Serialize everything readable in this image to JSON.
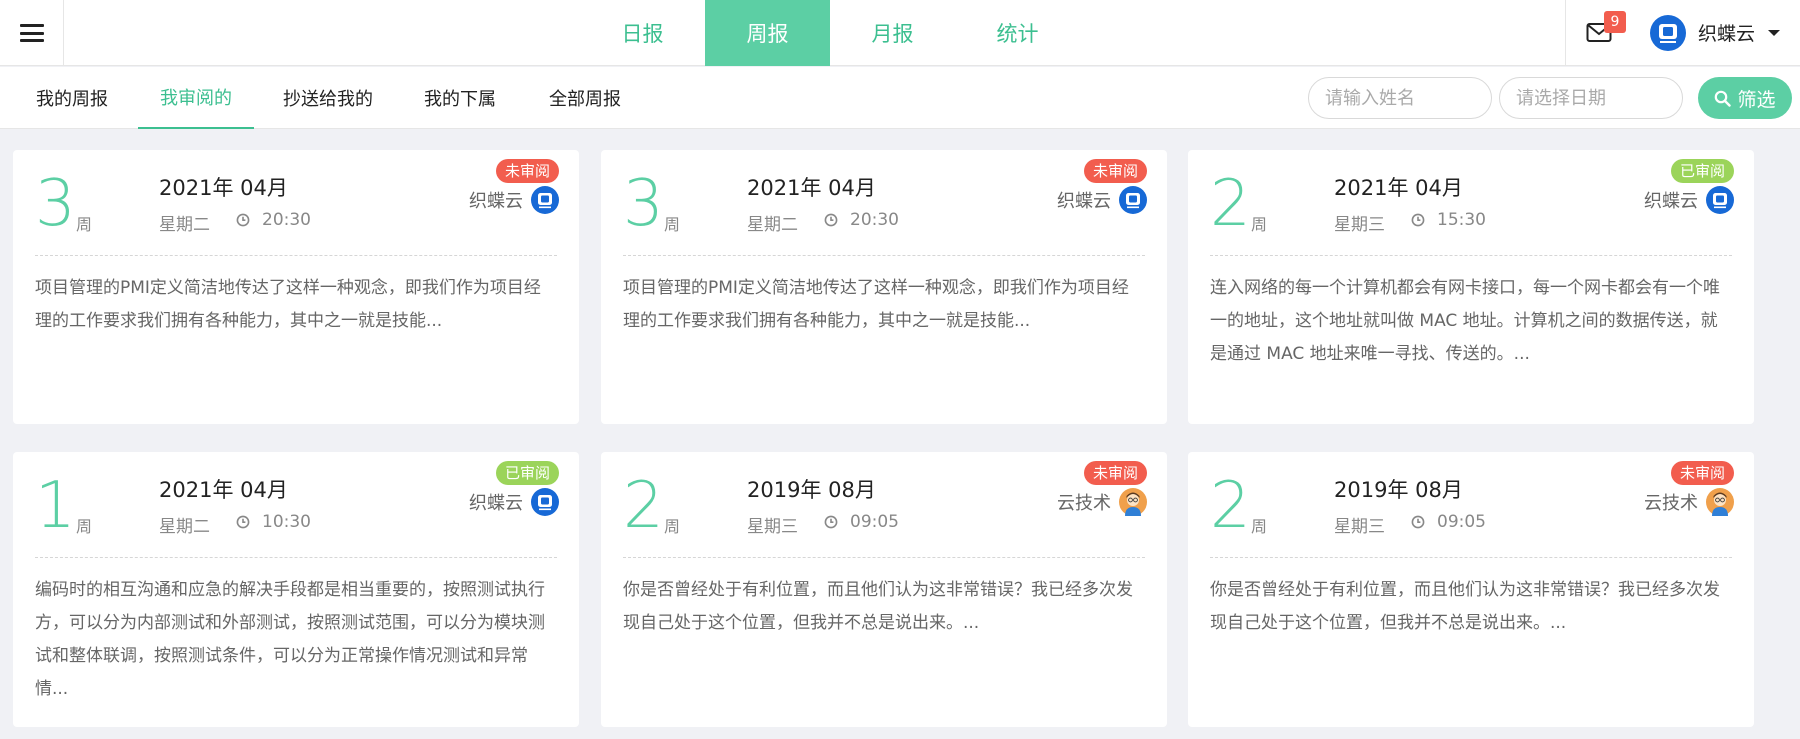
{
  "colors": {
    "accent": "#5ccfa4",
    "accent_text": "#3cbf90",
    "unread": "#f25d4e",
    "read": "#9bd45a"
  },
  "header": {
    "menu_icon": "hamburger-icon",
    "tabs": [
      {
        "label": "日报",
        "active": false
      },
      {
        "label": "周报",
        "active": true
      },
      {
        "label": "月报",
        "active": false
      },
      {
        "label": "统计",
        "active": false
      }
    ],
    "mail_icon": "mail-icon",
    "mail_count": "9",
    "user_name": "织蝶云"
  },
  "subnav": {
    "tabs": [
      {
        "label": "我的周报",
        "active": false
      },
      {
        "label": "我审阅的",
        "active": true
      },
      {
        "label": "抄送给我的",
        "active": false
      },
      {
        "label": "我的下属",
        "active": false
      },
      {
        "label": "全部周报",
        "active": false
      }
    ],
    "name_placeholder": "请输入姓名",
    "date_placeholder": "请选择日期",
    "filter_label": "筛选",
    "filter_icon": "search-icon"
  },
  "week_unit": "周",
  "cards": [
    {
      "week": "3",
      "date": "2021年 04月",
      "weekday": "星期二",
      "time": "20:30",
      "status": "未审阅",
      "status_type": "unread",
      "author": "织蝶云",
      "avatar": "brand",
      "excerpt": "项目管理的PMI定义简洁地传达了这样一种观念，即我们作为项目经理的工作要求我们拥有各种能力，其中之一就是技能..."
    },
    {
      "week": "3",
      "date": "2021年 04月",
      "weekday": "星期二",
      "time": "20:30",
      "status": "未审阅",
      "status_type": "unread",
      "author": "织蝶云",
      "avatar": "brand",
      "excerpt": "项目管理的PMI定义简洁地传达了这样一种观念，即我们作为项目经理的工作要求我们拥有各种能力，其中之一就是技能..."
    },
    {
      "week": "2",
      "date": "2021年 04月",
      "weekday": "星期三",
      "time": "15:30",
      "status": "已审阅",
      "status_type": "read",
      "author": "织蝶云",
      "avatar": "brand",
      "excerpt": "连入网络的每一个计算机都会有网卡接口，每一个网卡都会有一个唯一的地址，这个地址就叫做 MAC 地址。计算机之间的数据传送，就是通过 MAC 地址来唯一寻找、传送的。..."
    },
    {
      "week": "1",
      "date": "2021年 04月",
      "weekday": "星期二",
      "time": "10:30",
      "status": "已审阅",
      "status_type": "read",
      "author": "织蝶云",
      "avatar": "brand",
      "excerpt": "编码时的相互沟通和应急的解决手段都是相当重要的，按照测试执行方，可以分为内部测试和外部测试，按照测试范围，可以分为模块测试和整体联调，按照测试条件，可以分为正常操作情况测试和异常情..."
    },
    {
      "week": "2",
      "date": "2019年 08月",
      "weekday": "星期三",
      "time": "09:05",
      "status": "未审阅",
      "status_type": "unread",
      "author": "云技术",
      "avatar": "person",
      "excerpt": "你是否曾经处于有利位置，而且他们认为这非常错误？我已经多次发现自己处于这个位置，但我并不总是说出来。..."
    },
    {
      "week": "2",
      "date": "2019年 08月",
      "weekday": "星期三",
      "time": "09:05",
      "status": "未审阅",
      "status_type": "unread",
      "author": "云技术",
      "avatar": "person",
      "excerpt": "你是否曾经处于有利位置，而且他们认为这非常错误？我已经多次发现自己处于这个位置，但我并不总是说出来。..."
    }
  ]
}
